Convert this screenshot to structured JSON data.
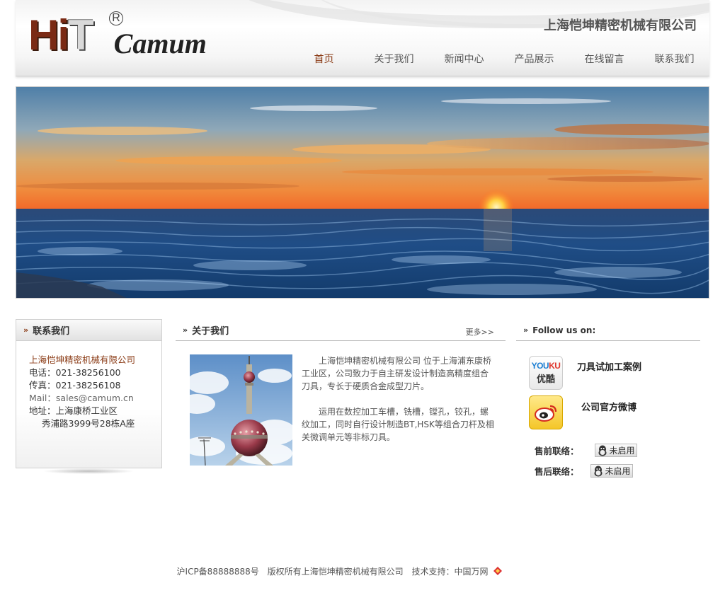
{
  "header": {
    "logo_mark": "HiT",
    "logo_reg": "R",
    "logo_text": "Camum",
    "company_name": "上海恺坤精密机械有限公司",
    "nav": [
      {
        "label": "首页",
        "active": true
      },
      {
        "label": "关于我们",
        "active": false
      },
      {
        "label": "新闻中心",
        "active": false
      },
      {
        "label": "产品展示",
        "active": false
      },
      {
        "label": "在线留言",
        "active": false
      },
      {
        "label": "联系我们",
        "active": false
      }
    ]
  },
  "contact": {
    "title": "联系我们",
    "company": "上海恺坤精密机械有限公司",
    "phone_label": "电话：",
    "phone": "021-38256100",
    "fax_label": "传真：",
    "fax": "021-38256108",
    "mail_label": "Mail：",
    "mail": "sales@camum.cn",
    "address_label": "地址：",
    "address_line1": "上海康桥工业区",
    "address_line2": "秀浦路3999号28栋A座"
  },
  "about": {
    "title": "关于我们",
    "more": "更多>>",
    "paragraph1": "上海恺坤精密机械有限公司 位于上海浦东康桥工业区，公司致力于自主研发设计制造高精度组合刀具，专长于硬质合金成型刀片。",
    "paragraph2": "运用在数控加工车槽，铣槽，镗孔，铰孔，螺纹加工，同时自行设计制造BT,HSK等组合刀杆及相关微调单元等非标刀具。"
  },
  "follow": {
    "title": "Follow us on:",
    "youku_label": "刀具试加工案例",
    "youku_icon_text_a": "YOU",
    "youku_icon_text_b": "KU",
    "youku_icon_cn": "优酷",
    "weibo_label": "公司官方微博",
    "presale_label": "售前联络：",
    "aftersale_label": "售后联络：",
    "qq_status": "未启用"
  },
  "footer": {
    "icp": "沪ICP备88888888号",
    "copyright": "版权所有上海恺坤精密机械有限公司",
    "support": "技术支持：中国万网"
  },
  "colors": {
    "accent": "#8a3a14",
    "nav_text": "#555555"
  }
}
